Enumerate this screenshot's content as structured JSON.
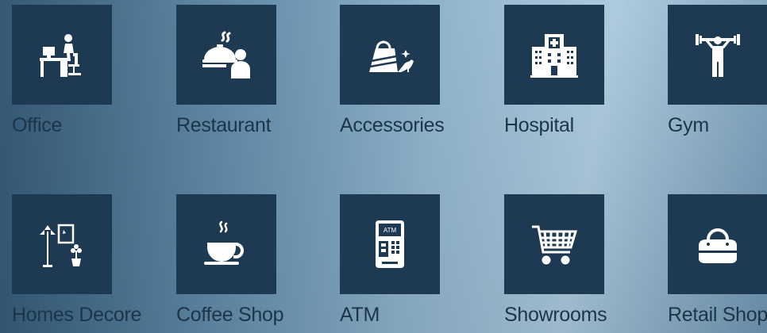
{
  "categories": [
    {
      "label": "Office",
      "icon": "office-desk-icon"
    },
    {
      "label": "Restaurant",
      "icon": "restaurant-waiter-icon"
    },
    {
      "label": "Accessories",
      "icon": "accessories-bag-heel-icon"
    },
    {
      "label": "Hospital",
      "icon": "hospital-building-icon"
    },
    {
      "label": "Gym",
      "icon": "gym-dumbbell-icon"
    },
    {
      "label": "Homes Decore",
      "icon": "home-decor-icon"
    },
    {
      "label": "Coffee Shop",
      "icon": "coffee-cup-icon"
    },
    {
      "label": "ATM",
      "icon": "atm-machine-icon"
    },
    {
      "label": "Showrooms",
      "icon": "shopping-cart-icon"
    },
    {
      "label": "Retail Shop",
      "icon": "handbag-icon"
    }
  ],
  "colors": {
    "tile_background": "#1d3a52",
    "label_text": "#1c3548",
    "icon_fill": "#ffffff"
  }
}
